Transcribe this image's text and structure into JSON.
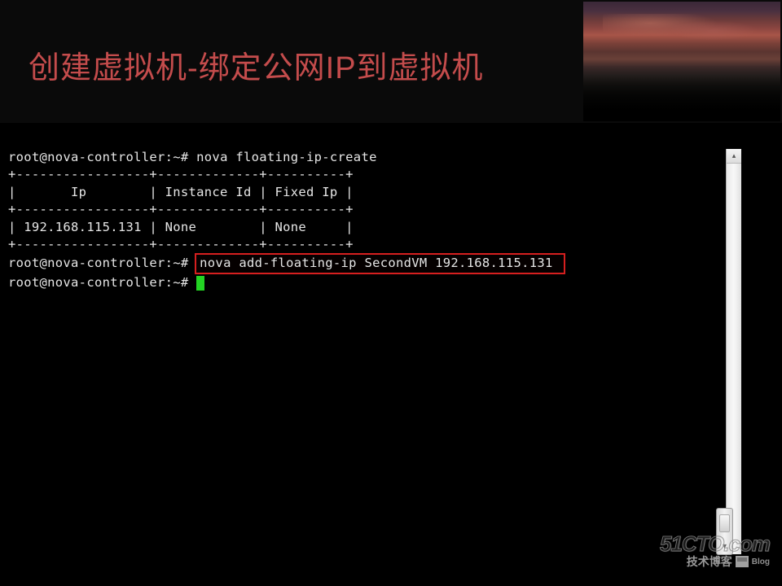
{
  "header": {
    "title": "创建虚拟机-绑定公网IP到虚拟机"
  },
  "terminal": {
    "prompt": "root@nova-controller:~#",
    "command1": "nova floating-ip-create",
    "table": {
      "border_top": "+-----------------+-------------+----------+",
      "header": "|       Ip        | Instance Id | Fixed Ip |",
      "border_mid": "+-----------------+-------------+----------+",
      "row1": "| 192.168.115.131 | None        | None     |",
      "border_bot": "+-----------------+-------------+----------+"
    },
    "command2_highlighted": "nova add-floating-ip SecondVM 192.168.115.131"
  },
  "watermark": {
    "main": "51CTO.com",
    "sub_cn": "技术博客",
    "sub_en": "Blog"
  },
  "accent_colors": {
    "title": "#c44c4c",
    "highlight_border": "#d61f1f",
    "cursor": "#23d423"
  }
}
